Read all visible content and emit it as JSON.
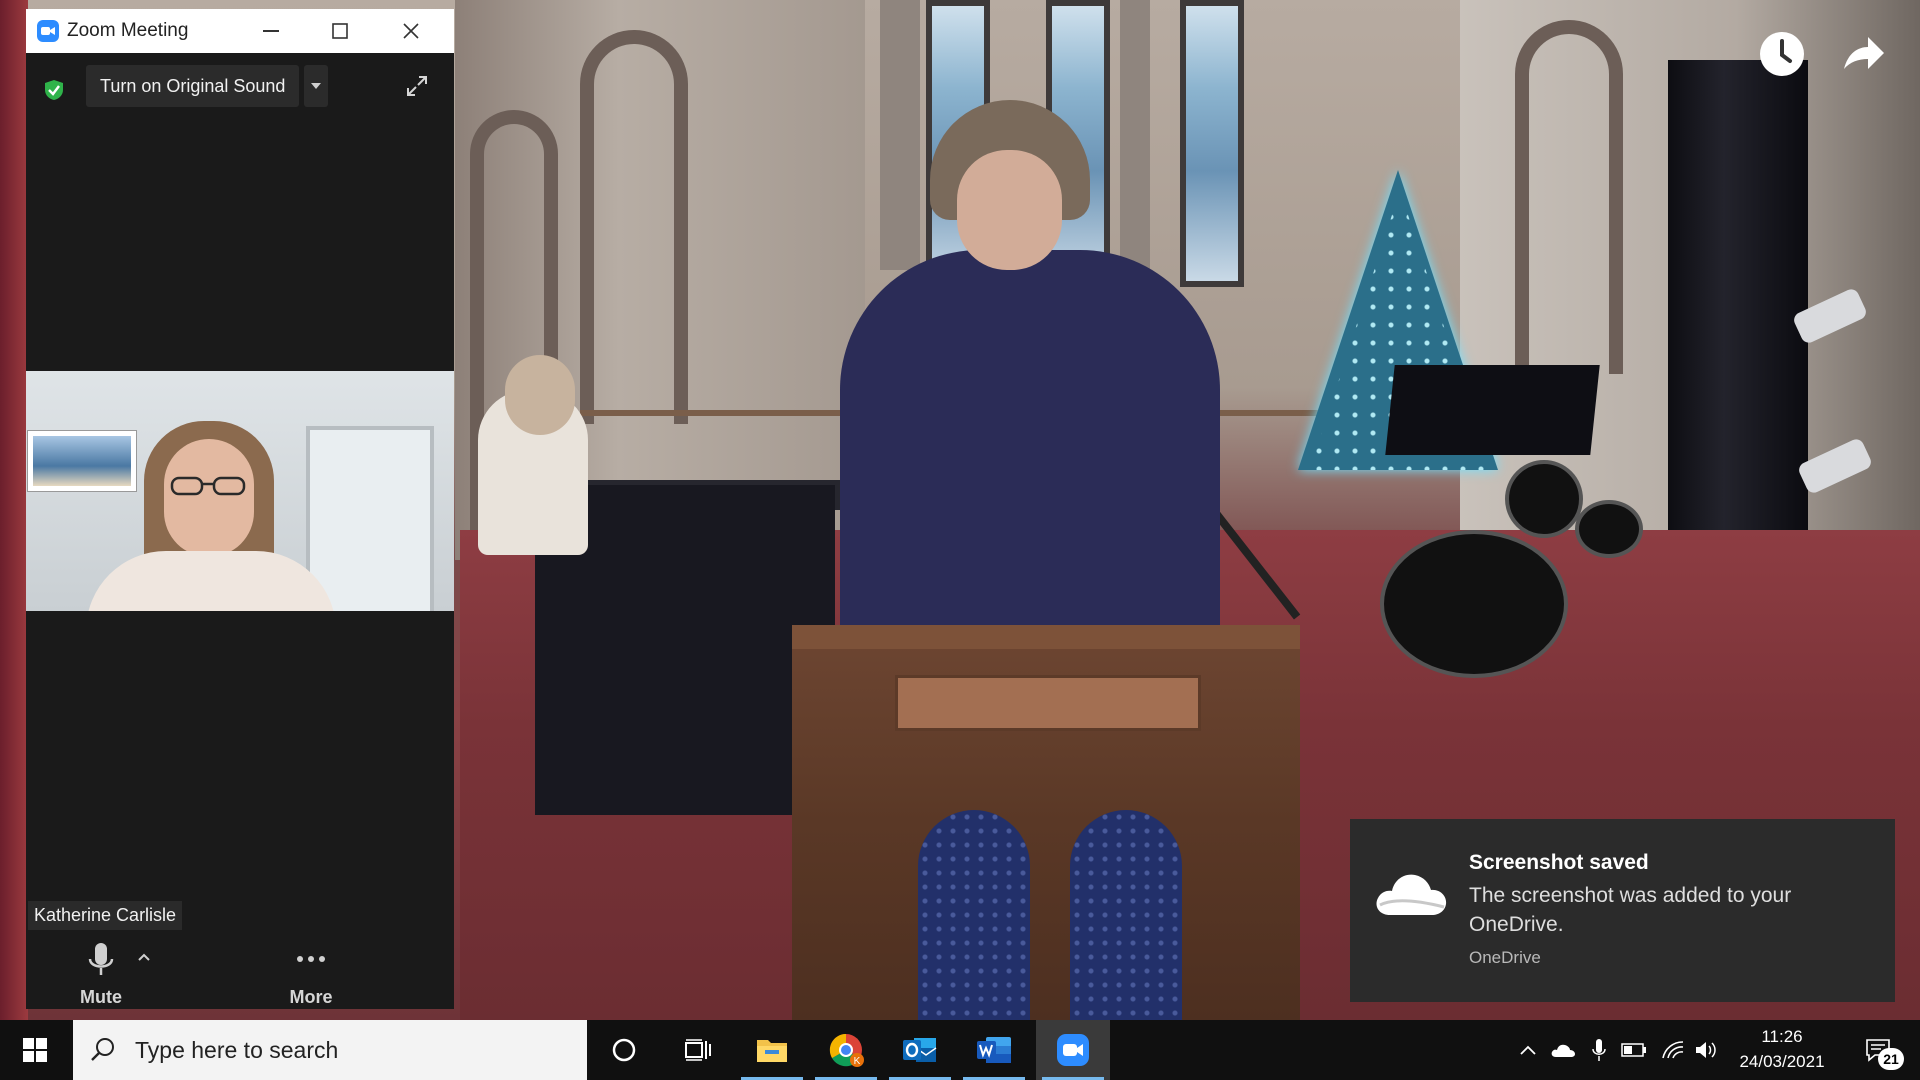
{
  "zoom": {
    "title": "Zoom Meeting",
    "original_sound_label": "Turn on Original Sound",
    "participant_name": "Katherine Carlisle",
    "controls": {
      "mute_label": "Mute",
      "more_label": "More"
    },
    "icons": [
      "zoom-logo-icon",
      "minimize-icon",
      "maximize-icon",
      "close-icon",
      "shield-check-icon",
      "chevron-down-icon",
      "expand-icon",
      "microphone-icon",
      "chevron-up-icon",
      "more-dots-icon"
    ]
  },
  "overlay": {
    "icons": [
      "clock-icon",
      "share-arrow-icon"
    ]
  },
  "toast": {
    "title": "Screenshot saved",
    "body": "The screenshot was added to your OneDrive.",
    "source": "OneDrive",
    "icon": "onedrive-cloud-icon"
  },
  "taskbar": {
    "search_placeholder": "Type here to search",
    "apps": [
      "cortana-icon",
      "task-view-icon",
      "file-explorer-icon",
      "chrome-icon",
      "outlook-icon",
      "word-icon",
      "zoom-app-icon"
    ],
    "tray": [
      "chevron-up-icon",
      "onedrive-icon",
      "microphone-icon",
      "battery-icon",
      "wifi-icon",
      "speaker-icon"
    ],
    "time": "11:26",
    "date": "24/03/2021",
    "notification_count": "21"
  },
  "colors": {
    "zoom_blue": "#2d8cff",
    "taskbar_bg": "#101010",
    "toast_bg": "#2b2b2b",
    "active_underline": "#76b9ed"
  }
}
